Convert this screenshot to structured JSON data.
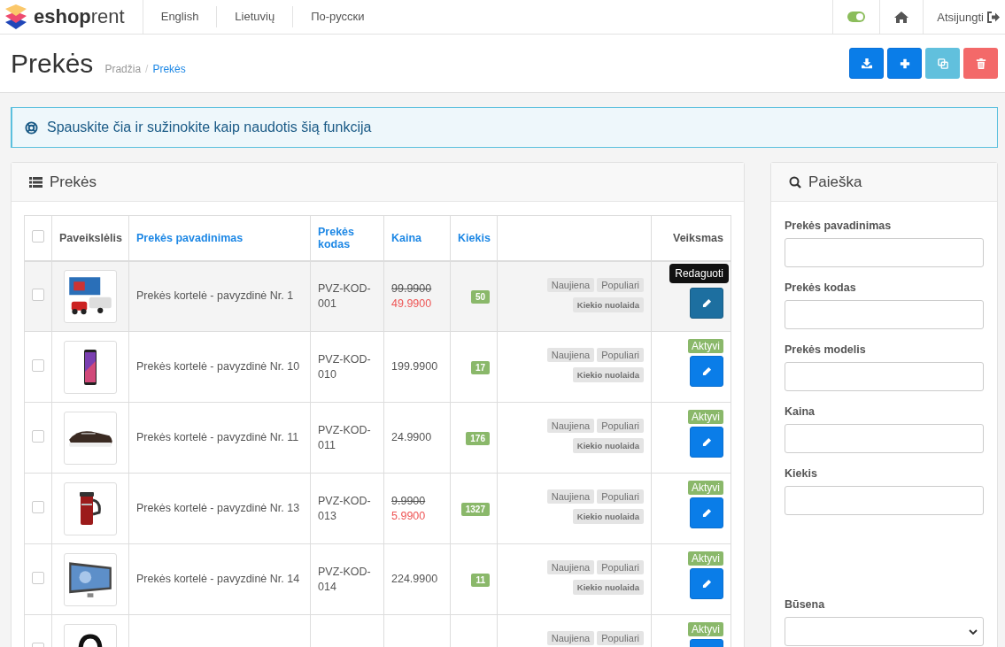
{
  "brand": {
    "bold": "eshop",
    "light": "rent"
  },
  "languages": [
    "English",
    "Lietuvių",
    "По-русски"
  ],
  "nav_toggle": {
    "on": true
  },
  "logout": "Atsijungti",
  "page_title": "Prekės",
  "breadcrumb_separator": "/",
  "breadcrumb": [
    {
      "label": "Pradžia",
      "current": false
    },
    {
      "label": "Prekės",
      "current": true
    }
  ],
  "toolbar_buttons": [
    {
      "kind": "download",
      "disabled": false
    },
    {
      "kind": "add",
      "disabled": false
    },
    {
      "kind": "copy",
      "disabled": true
    },
    {
      "kind": "delete",
      "disabled": true
    }
  ],
  "help_banner": "Spauskite čia ir sužinokite kaip naudotis šią funkcija",
  "products_panel": {
    "title": "Prekės",
    "select_all": {
      "checked": false
    },
    "columns": [
      {
        "label": "Paveikslėlis",
        "sortable": false
      },
      {
        "label": "Prekės pavadinimas",
        "sortable": true
      },
      {
        "label": "Prekės kodas",
        "sortable": true
      },
      {
        "label": "Kaina",
        "sortable": true
      },
      {
        "label": "Kiekis",
        "sortable": true
      },
      {
        "label": "Veiksmas",
        "sortable": false
      }
    ],
    "rows": [
      {
        "checked": false,
        "hovered": true,
        "name": "Prekės kortelė - pavyzdinė Nr. 1",
        "code": "PVZ-KOD-001",
        "old_price": "99.9900",
        "price": "49.9900",
        "quantity": "50",
        "flags": [
          {
            "label": "Naujiena",
            "on": false
          },
          {
            "label": "Populiari",
            "on": false
          },
          {
            "label": "Kiekio nuolaida",
            "on": false
          }
        ],
        "tooltip": "Redaguoti"
      },
      {
        "checked": false,
        "hovered": false,
        "name": "Prekės kortelė - pavyzdinė Nr. 10",
        "code": "PVZ-KOD-010",
        "price": "199.9900",
        "quantity": "17",
        "flags": [
          {
            "label": "Naujiena",
            "on": false
          },
          {
            "label": "Populiari",
            "on": false
          },
          {
            "label": "Kiekio nuolaida",
            "on": false
          }
        ],
        "status": "Aktyvi"
      },
      {
        "checked": false,
        "hovered": false,
        "name": "Prekės kortelė - pavyzdinė Nr. 11",
        "code": "PVZ-KOD-011",
        "price": "24.9900",
        "quantity": "176",
        "flags": [
          {
            "label": "Naujiena",
            "on": false
          },
          {
            "label": "Populiari",
            "on": false
          },
          {
            "label": "Kiekio nuolaida",
            "on": false
          }
        ],
        "status": "Aktyvi"
      },
      {
        "checked": false,
        "hovered": false,
        "name": "Prekės kortelė - pavyzdinė Nr. 13",
        "code": "PVZ-KOD-013",
        "old_price": "9.9900",
        "price": "5.9900",
        "quantity": "1327",
        "flags": [
          {
            "label": "Naujiena",
            "on": false
          },
          {
            "label": "Populiari",
            "on": false
          },
          {
            "label": "Kiekio nuolaida",
            "on": false
          }
        ],
        "status": "Aktyvi"
      },
      {
        "checked": false,
        "hovered": false,
        "name": "Prekės kortelė - pavyzdinė Nr. 14",
        "code": "PVZ-KOD-014",
        "price": "224.9900",
        "quantity": "11",
        "flags": [
          {
            "label": "Naujiena",
            "on": false
          },
          {
            "label": "Populiari",
            "on": false
          },
          {
            "label": "Kiekio nuolaida",
            "on": false
          }
        ],
        "status": "Aktyvi"
      },
      {
        "checked": false,
        "hovered": false,
        "flags": [
          {
            "label": "Naujiena",
            "on": false
          },
          {
            "label": "Populiari",
            "on": false
          }
        ],
        "status": "Aktyvi"
      }
    ]
  },
  "search_panel": {
    "title": "Paieška",
    "fields": [
      {
        "label": "Prekės pavadinimas",
        "kind": "text"
      },
      {
        "label": "Prekės kodas",
        "kind": "text"
      },
      {
        "label": "Prekės modelis",
        "kind": "text"
      },
      {
        "label": "Kaina",
        "kind": "text"
      },
      {
        "label": "Kiekis",
        "kind": "text"
      },
      {
        "label": "Būsena",
        "kind": "select"
      }
    ]
  }
}
